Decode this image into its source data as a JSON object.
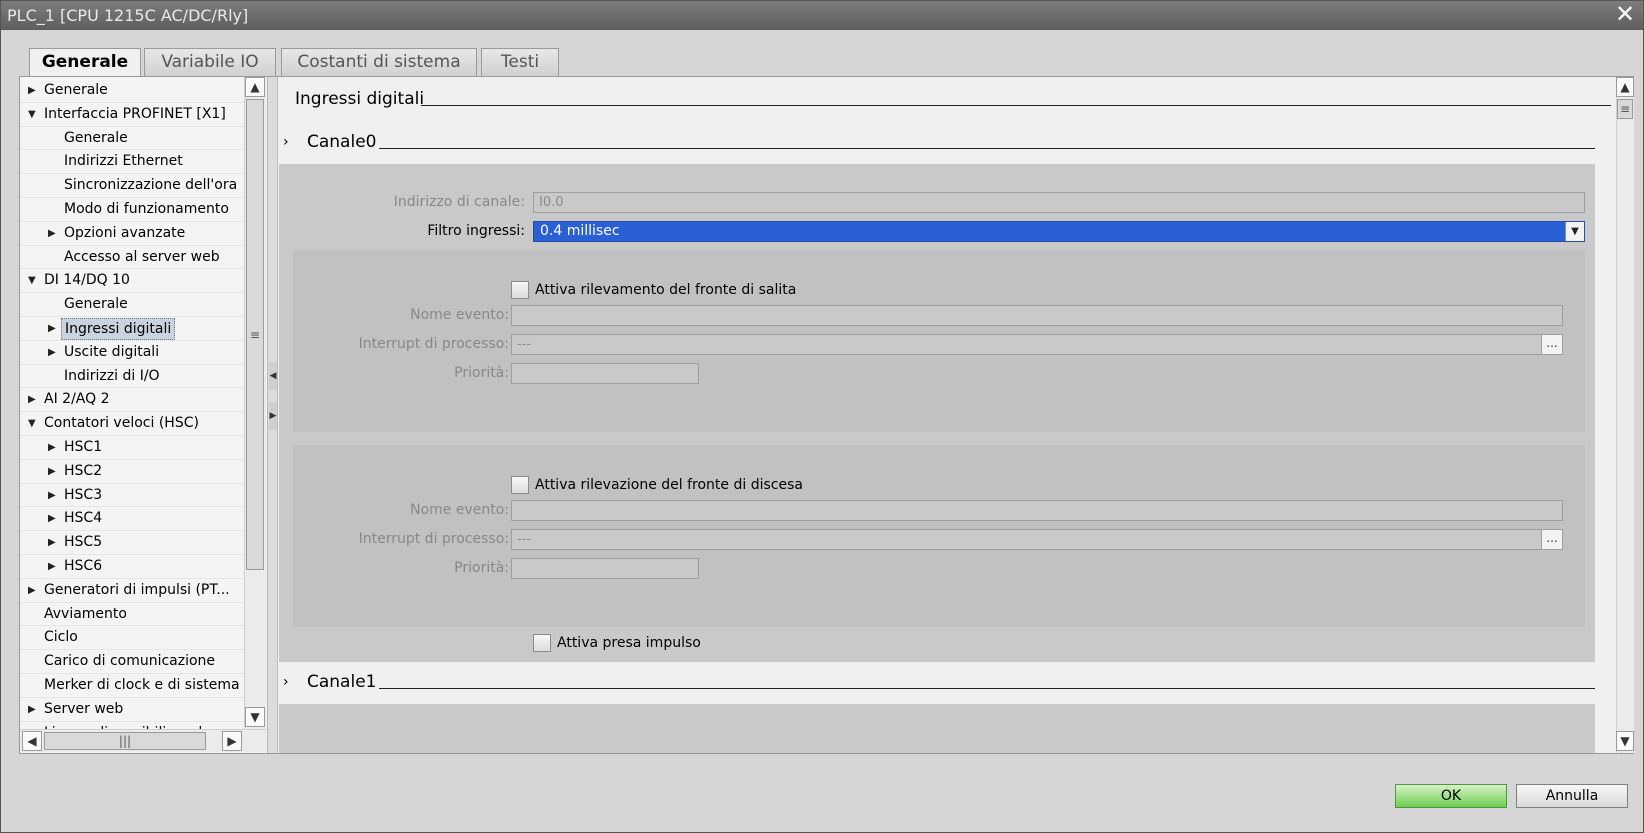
{
  "window": {
    "title": "PLC_1 [CPU 1215C AC/DC/Rly]"
  },
  "tabs": [
    {
      "label": "Generale",
      "active": true
    },
    {
      "label": "Variabile IO"
    },
    {
      "label": "Costanti di sistema"
    },
    {
      "label": "Testi"
    }
  ],
  "tree": [
    {
      "label": "Generale",
      "level": 0,
      "arrow": "right"
    },
    {
      "label": "Interfaccia PROFINET [X1]",
      "level": 0,
      "arrow": "down"
    },
    {
      "label": "Generale",
      "level": 1
    },
    {
      "label": "Indirizzi Ethernet",
      "level": 1
    },
    {
      "label": "Sincronizzazione dell'ora",
      "level": 1
    },
    {
      "label": "Modo di funzionamento",
      "level": 1
    },
    {
      "label": "Opzioni avanzate",
      "level": 1,
      "arrow": "right"
    },
    {
      "label": "Accesso al server web",
      "level": 1
    },
    {
      "label": "DI 14/DQ 10",
      "level": 0,
      "arrow": "down"
    },
    {
      "label": "Generale",
      "level": 1
    },
    {
      "label": "Ingressi digitali",
      "level": 1,
      "arrow": "right",
      "selected": true
    },
    {
      "label": "Uscite digitali",
      "level": 1,
      "arrow": "right"
    },
    {
      "label": "Indirizzi di I/O",
      "level": 1
    },
    {
      "label": "AI 2/AQ 2",
      "level": 0,
      "arrow": "right"
    },
    {
      "label": "Contatori veloci (HSC)",
      "level": 0,
      "arrow": "down"
    },
    {
      "label": "HSC1",
      "level": 1,
      "arrow": "right"
    },
    {
      "label": "HSC2",
      "level": 1,
      "arrow": "right"
    },
    {
      "label": "HSC3",
      "level": 1,
      "arrow": "right"
    },
    {
      "label": "HSC4",
      "level": 1,
      "arrow": "right"
    },
    {
      "label": "HSC5",
      "level": 1,
      "arrow": "right"
    },
    {
      "label": "HSC6",
      "level": 1,
      "arrow": "right"
    },
    {
      "label": "Generatori di impulsi (PT...",
      "level": 0,
      "arrow": "right"
    },
    {
      "label": "Avviamento",
      "level": 0
    },
    {
      "label": "Ciclo",
      "level": 0
    },
    {
      "label": "Carico di comunicazione",
      "level": 0
    },
    {
      "label": "Merker di clock e di sistema",
      "level": 0
    },
    {
      "label": "Server web",
      "level": 0,
      "arrow": "right"
    },
    {
      "label": "Lingue disponibili per le",
      "level": 0
    }
  ],
  "main": {
    "section_title": "Ingressi digitali",
    "channel0": {
      "title": "Canale0",
      "address_label": "Indirizzo di canale:",
      "address_value": "I0.0",
      "filter_label": "Filtro ingressi:",
      "filter_value": "0.4 millisec",
      "rising": {
        "check_label": "Attiva rilevamento del fronte di salita",
        "event_label": "Nome evento:",
        "event_value": "",
        "interrupt_label": "Interrupt di processo:",
        "interrupt_value": "---",
        "priority_label": "Priorità:",
        "priority_value": ""
      },
      "falling": {
        "check_label": "Attiva rilevazione del fronte di discesa",
        "event_label": "Nome evento:",
        "event_value": "",
        "interrupt_label": "Interrupt di processo:",
        "interrupt_value": "---",
        "priority_label": "Priorità:",
        "priority_value": ""
      },
      "pulse_label": "Attiva presa impulso"
    },
    "channel1": {
      "title": "Canale1"
    }
  },
  "buttons": {
    "ok": "OK",
    "cancel": "Annulla"
  },
  "icons": {
    "browse": "...",
    "dropdown": "▼",
    "expand": "›"
  },
  "colors": {
    "selection": "#2a5fd6",
    "ok_button": "#6fcf52"
  }
}
